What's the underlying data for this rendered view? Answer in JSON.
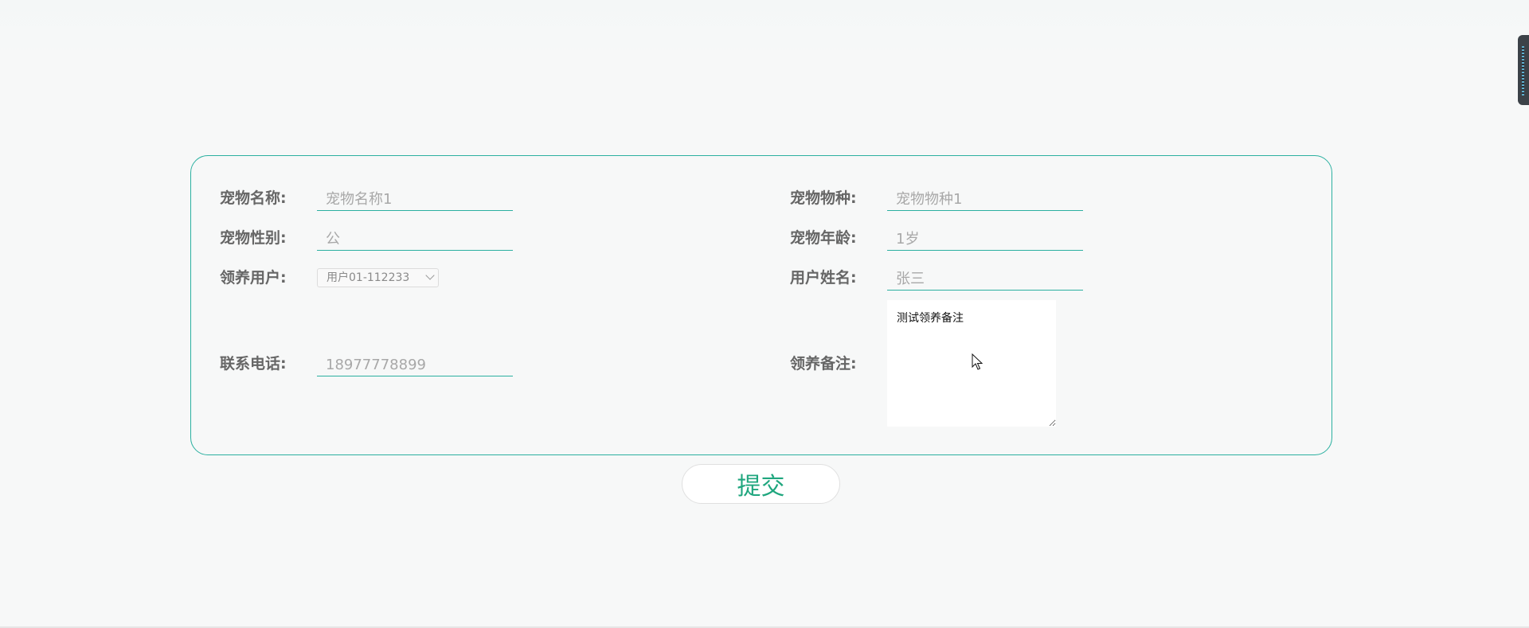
{
  "form": {
    "pet_name": {
      "label": "宠物名称:",
      "value": "宠物名称1"
    },
    "pet_species": {
      "label": "宠物物种:",
      "value": "宠物物种1"
    },
    "pet_gender": {
      "label": "宠物性别:",
      "value": "公"
    },
    "pet_age": {
      "label": "宠物年龄:",
      "value": "1岁"
    },
    "adopt_user": {
      "label": "领养用户:",
      "selected": "用户01-112233"
    },
    "user_name": {
      "label": "用户姓名:",
      "value": "张三"
    },
    "phone": {
      "label": "联系电话:",
      "value": "18977778899"
    },
    "remark": {
      "label": "领养备注:",
      "value": "测试领养备注"
    }
  },
  "submit_label": "提交",
  "colors": {
    "accent": "#2bb0a0",
    "submit_text": "#1fa67e",
    "label_text": "#666666"
  },
  "icons": {
    "select": "chevron-down-icon",
    "cursor": "mouse-cursor-icon"
  }
}
